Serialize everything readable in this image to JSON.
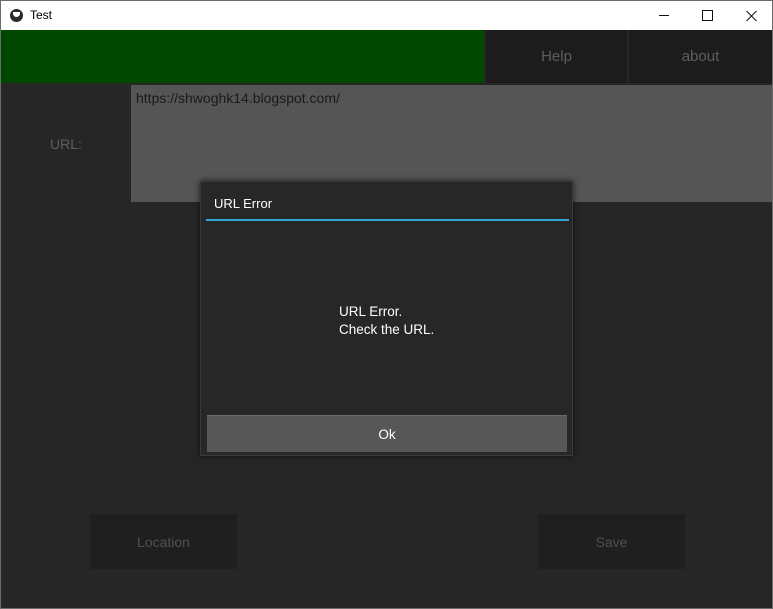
{
  "window": {
    "title": "Test",
    "icon": "app-icon"
  },
  "toolbar": {
    "help_label": "Help",
    "about_label": "about"
  },
  "form": {
    "url_label": "URL:",
    "url_value": "https://shwoghk14.blogspot.com/"
  },
  "actions": {
    "location_label": "Location",
    "save_label": "Save"
  },
  "popup": {
    "title": "URL Error",
    "message_line1": "URL Error.",
    "message_line2": "Check the URL.",
    "ok_label": "Ok"
  },
  "colors": {
    "header_green": "#004800",
    "popup_separator": "#33a4d3",
    "background": "#262626"
  }
}
